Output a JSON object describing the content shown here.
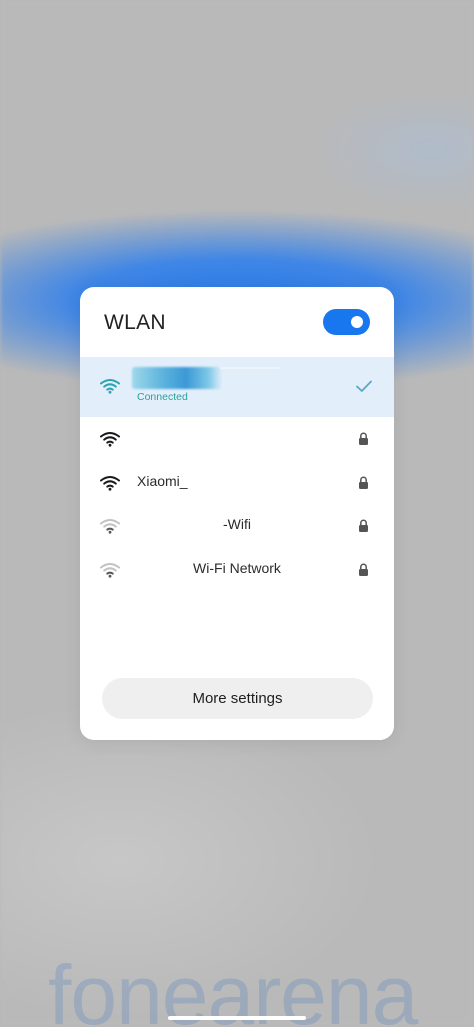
{
  "panel": {
    "title": "WLAN",
    "toggle_on": true
  },
  "networks": [
    {
      "ssid": "",
      "status": "Connected",
      "connected": true,
      "secured": false,
      "signal": "strong"
    },
    {
      "ssid": "",
      "secured": true,
      "signal": "strong"
    },
    {
      "ssid": "Xiaomi_",
      "secured": true,
      "signal": "strong"
    },
    {
      "ssid": "-Wifi",
      "secured": true,
      "signal": "weak"
    },
    {
      "ssid": "Wi-Fi Network",
      "secured": true,
      "signal": "weak"
    }
  ],
  "more_settings": "More settings",
  "watermark": "fonearena",
  "icons": {
    "wifi": "wifi-icon",
    "lock": "lock-icon",
    "check": "check-icon"
  },
  "colors": {
    "accent": "#1877ee",
    "connected_row": "#e3eefb",
    "connected_text": "#2aa198"
  }
}
